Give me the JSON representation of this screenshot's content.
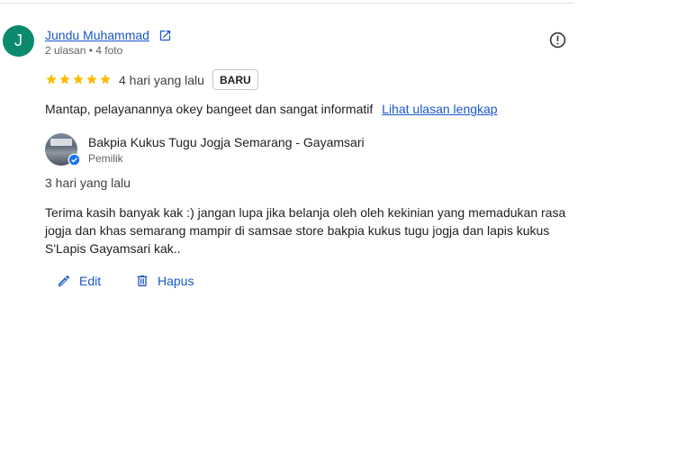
{
  "reviewer": {
    "initial": "J",
    "avatar_color": "#0b8a6e",
    "name": "Jundu Muhammad",
    "meta": "2 ulasan • 4 foto"
  },
  "review": {
    "rating": 5,
    "time": "4 hari yang lalu",
    "badge": "BARU",
    "text": "Mantap, pelayanannya okey bangeet dan sangat informatif",
    "full_review_link": "Lihat ulasan lengkap"
  },
  "owner_reply": {
    "business_name": "Bakpia Kukus Tugu Jogja Semarang - Gayamsari",
    "role": "Pemilik",
    "time": "3 hari yang lalu",
    "text": "Terima kasih banyak kak :) jangan lupa jika belanja oleh oleh kekinian yang memadukan rasa jogja dan khas semarang mampir di samsae store bakpia kukus tugu jogja dan lapis kukus S'Lapis Gayamsari kak.."
  },
  "actions": {
    "edit_label": "Edit",
    "delete_label": "Hapus"
  },
  "colors": {
    "link": "#1a57c7",
    "star": "#fbbc04",
    "verified": "#1a73e8"
  },
  "icons": [
    "external-link-icon",
    "report-icon",
    "star-icon",
    "verified-icon",
    "pencil-icon",
    "trash-icon"
  ]
}
